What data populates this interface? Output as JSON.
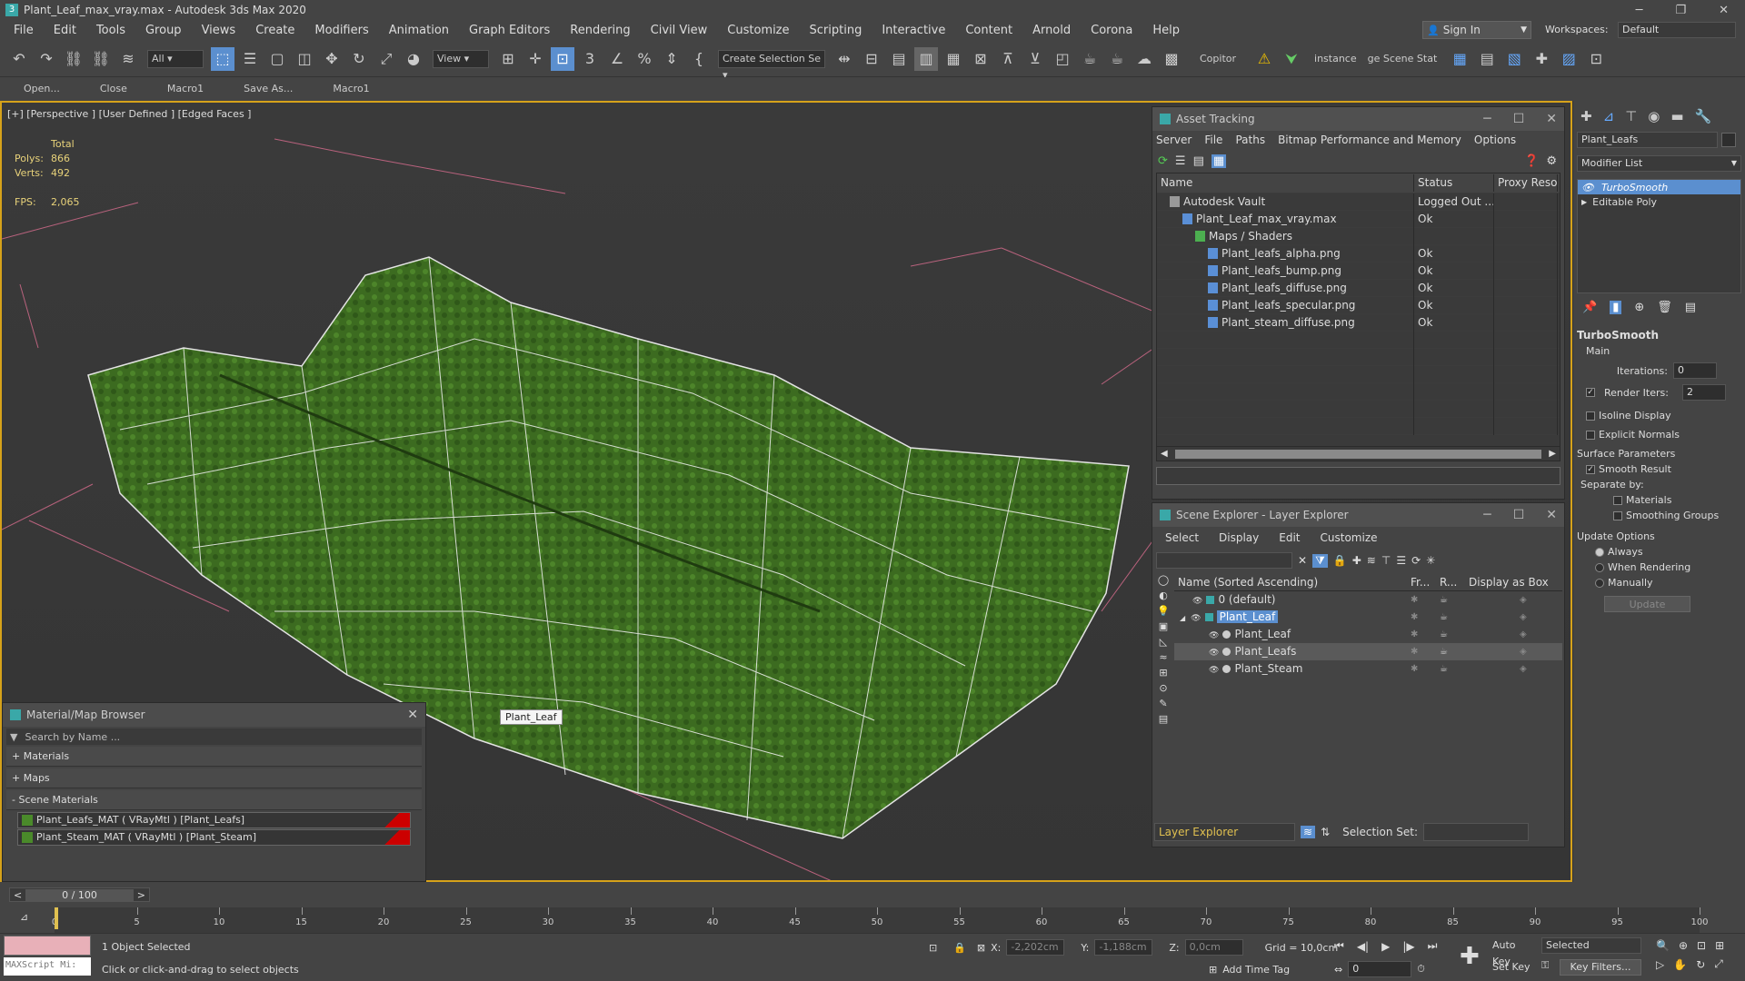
{
  "app": {
    "title": "Plant_Leaf_max_vray.max - Autodesk 3ds Max 2020",
    "sign_in": "Sign In",
    "workspaces_label": "Workspaces:",
    "workspace": "Default"
  },
  "menu": [
    "File",
    "Edit",
    "Tools",
    "Group",
    "Views",
    "Create",
    "Modifiers",
    "Animation",
    "Graph Editors",
    "Rendering",
    "Civil View",
    "Customize",
    "Scripting",
    "Interactive",
    "Content",
    "Arnold",
    "Corona",
    "Help"
  ],
  "toolbar": {
    "filter": "All",
    "ref_coord": "View",
    "selection_set": "Create Selection Se",
    "copitor": "Copitor",
    "instance": "instance",
    "scene_state": "ge Scene Stat"
  },
  "macros": [
    "Open...",
    "Close",
    "Macro1",
    "Save As...",
    "Macro1"
  ],
  "viewport": {
    "label": "[+] [Perspective ] [User Defined ] [Edged Faces ]",
    "stats_total": "Total",
    "polys_label": "Polys:",
    "polys": "866",
    "verts_label": "Verts:",
    "verts": "492",
    "fps_label": "FPS:",
    "fps": "2,065",
    "tooltip": "Plant_Leaf"
  },
  "asset_tracking": {
    "title": "Asset Tracking",
    "menu": [
      "Server",
      "File",
      "Paths",
      "Bitmap Performance and Memory",
      "Options"
    ],
    "cols": [
      "Name",
      "Status",
      "Proxy Resol"
    ],
    "rows": [
      {
        "name": "Autodesk Vault",
        "status": "Logged Out ...",
        "indent": 1
      },
      {
        "name": "Plant_Leaf_max_vray.max",
        "status": "Ok",
        "indent": 2
      },
      {
        "name": "Maps / Shaders",
        "status": "",
        "indent": 3
      },
      {
        "name": "Plant_leafs_alpha.png",
        "status": "Ok",
        "indent": 4
      },
      {
        "name": "Plant_leafs_bump.png",
        "status": "Ok",
        "indent": 4
      },
      {
        "name": "Plant_leafs_diffuse.png",
        "status": "Ok",
        "indent": 4
      },
      {
        "name": "Plant_leafs_specular.png",
        "status": "Ok",
        "indent": 4
      },
      {
        "name": "Plant_steam_diffuse.png",
        "status": "Ok",
        "indent": 4
      }
    ]
  },
  "scene_explorer": {
    "title": "Scene Explorer - Layer Explorer",
    "menu": [
      "Select",
      "Display",
      "Edit",
      "Customize"
    ],
    "cols": [
      "Name (Sorted Ascending)",
      "Fr...",
      "R...",
      "Display as Box"
    ],
    "rows": [
      {
        "name": "0 (default)",
        "indent": 1
      },
      {
        "name": "Plant_Leaf",
        "indent": 1
      },
      {
        "name": "Plant_Leaf",
        "indent": 2
      },
      {
        "name": "Plant_Leafs",
        "indent": 2
      },
      {
        "name": "Plant_Steam",
        "indent": 2
      }
    ],
    "footer_mode": "Layer Explorer",
    "selection_set_label": "Selection Set:"
  },
  "mat_browser": {
    "title": "Material/Map Browser",
    "search": "Search by Name ...",
    "sections": [
      "+ Materials",
      "+ Maps",
      "- Scene Materials"
    ],
    "materials": [
      "Plant_Leafs_MAT  ( VRayMtl )  [Plant_Leafs]",
      "Plant_Steam_MAT  ( VRayMtl )  [Plant_Steam]"
    ]
  },
  "cmd": {
    "object_name": "Plant_Leafs",
    "modifier_list": "Modifier List",
    "stack": [
      "TurboSmooth",
      "Editable Poly"
    ],
    "rollout": "TurboSmooth",
    "main": "Main",
    "iterations_label": "Iterations:",
    "iterations": "0",
    "render_iters_label": "Render Iters:",
    "render_iters": "2",
    "isoline": "Isoline Display",
    "explicit": "Explicit Normals",
    "surface_params": "Surface Parameters",
    "smooth_result": "Smooth Result",
    "separate_by": "Separate by:",
    "materials": "Materials",
    "smoothing_groups": "Smoothing Groups",
    "update_options": "Update Options",
    "always": "Always",
    "when_rendering": "When Rendering",
    "manually": "Manually",
    "update": "Update"
  },
  "timeline": {
    "frame": "0 / 100",
    "ticks": [
      "0",
      "5",
      "10",
      "15",
      "20",
      "25",
      "30",
      "35",
      "40",
      "45",
      "50",
      "55",
      "60",
      "65",
      "70",
      "75",
      "80",
      "85",
      "90",
      "95",
      "100"
    ]
  },
  "status": {
    "maxscript": "MAXScript Mi:",
    "selected": "1 Object Selected",
    "prompt": "Click or click-and-drag to select objects",
    "x_label": "X:",
    "x": "-2,202cm",
    "y_label": "Y:",
    "y": "-1,188cm",
    "z_label": "Z:",
    "z": "0,0cm",
    "grid": "Grid = 10,0cm",
    "add_time_tag": "Add Time Tag",
    "auto_key": "Auto Key",
    "set_key": "Set Key",
    "key_mode": "Selected",
    "key_filters": "Key Filters...",
    "frame": "0"
  }
}
